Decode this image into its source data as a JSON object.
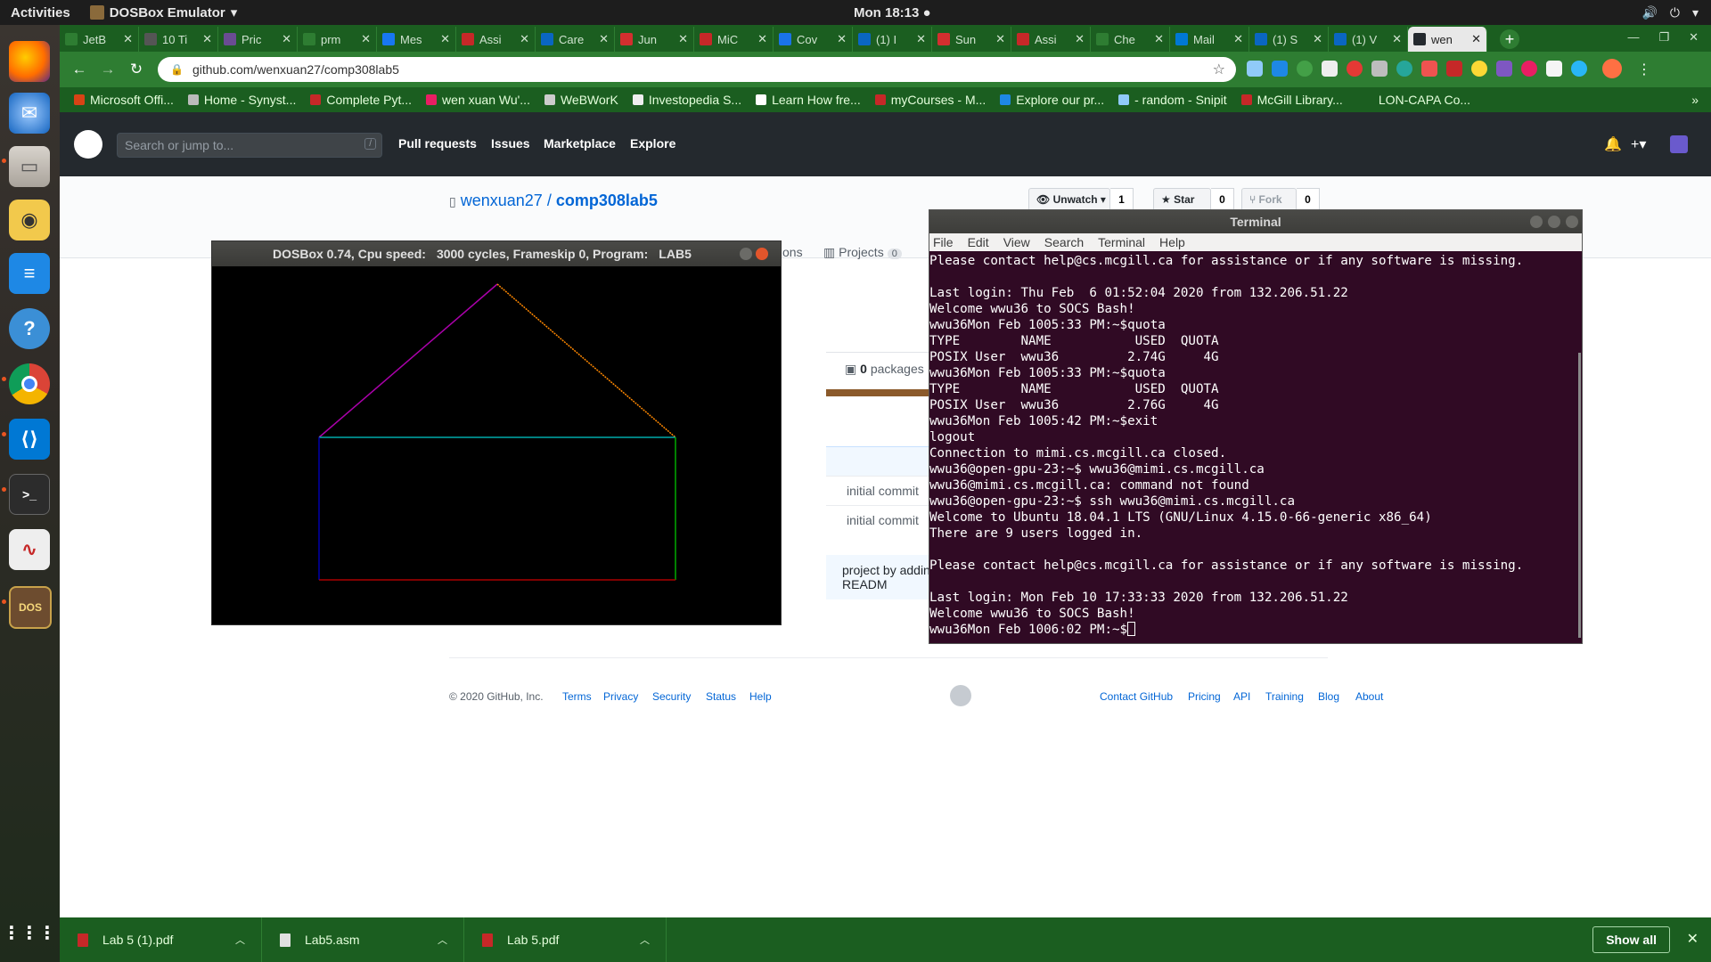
{
  "topbar": {
    "activities": "Activities",
    "app_name": "DOSBox Emulator",
    "clock": "Mon 18:13"
  },
  "dock": {
    "items": [
      "firefox-icon",
      "thunderbird-icon",
      "files-icon",
      "rhythmbox-icon",
      "libreoffice-writer-icon",
      "help-icon",
      "chrome-icon",
      "vscode-icon",
      "terminal-icon",
      "evince-icon",
      "dosbox-icon",
      "show-apps-icon"
    ]
  },
  "browser": {
    "tabs": [
      {
        "label": "JetB",
        "color": "#2e7d32"
      },
      {
        "label": "10 Ti",
        "color": "#555555"
      },
      {
        "label": "Pric",
        "color": "#6a4c93"
      },
      {
        "label": "prm",
        "color": "#2e7d32"
      },
      {
        "label": "Mes",
        "color": "#1877f2"
      },
      {
        "label": "Assi",
        "color": "#c62828"
      },
      {
        "label": "Care",
        "color": "#0a66c2"
      },
      {
        "label": "Jun",
        "color": "#d32f2f"
      },
      {
        "label": "MiC",
        "color": "#c62828"
      },
      {
        "label": "Cov",
        "color": "#1a73e8"
      },
      {
        "label": "(1) I",
        "color": "#0a66c2"
      },
      {
        "label": "Sun",
        "color": "#d32f2f"
      },
      {
        "label": "Assi",
        "color": "#c62828"
      },
      {
        "label": "Che",
        "color": "#2e7d32"
      },
      {
        "label": "Mail",
        "color": "#0078d4"
      },
      {
        "label": "(1) S",
        "color": "#0a66c2"
      },
      {
        "label": "(1) V",
        "color": "#0a66c2"
      },
      {
        "label": "wen",
        "color": "#24292e"
      }
    ],
    "url": "github.com/wenxuan27/comp308lab5",
    "bookmarks": [
      "Microsoft Offi...",
      "Home - Synyst...",
      "Complete Pyt...",
      "wen xuan Wu'...",
      "WeBWorK",
      "Investopedia S...",
      "Learn How fre...",
      "myCourses - M...",
      "Explore our pr...",
      "- random - Snipit",
      "McGill Library...",
      "LON-CAPA Co..."
    ]
  },
  "github": {
    "search_placeholder": "Search or jump to...",
    "search_shortcut": "/",
    "nav": [
      "Pull requests",
      "Issues",
      "Marketplace",
      "Explore"
    ],
    "owner": "wenxuan27",
    "separator": "/",
    "repo": "comp308lab5",
    "unwatch_label": "Unwatch",
    "unwatch_count": "1",
    "star_label": "Star",
    "star_count": "0",
    "fork_label": "Fork",
    "fork_count": "0",
    "tab_fragment": "ons",
    "projects_label": "Projects",
    "projects_count": "0",
    "packages_count": "0",
    "packages_label": "packages",
    "commits": [
      "initial commit",
      "initial commit"
    ],
    "readme_prompt": "project by adding a READM",
    "footer": {
      "copyright": "© 2020 GitHub, Inc.",
      "left_links": [
        "Terms",
        "Privacy",
        "Security",
        "Status",
        "Help"
      ],
      "right_links": [
        "Contact GitHub",
        "Pricing",
        "API",
        "Training",
        "Blog",
        "About"
      ]
    }
  },
  "dosbox": {
    "title_prefix": "DOSBox 0.74, Cpu speed:",
    "title_cycles": "3000 cycles, Frameskip  0, Program:",
    "title_program": "LAB5"
  },
  "terminal": {
    "title": "Terminal",
    "menu": [
      "File",
      "Edit",
      "View",
      "Search",
      "Terminal",
      "Help"
    ],
    "lines": [
      "Please contact help@cs.mcgill.ca for assistance or if any software is missing.",
      "",
      "Last login: Thu Feb  6 01:52:04 2020 from 132.206.51.22",
      "Welcome wwu36 to SOCS Bash!",
      "wwu36Mon Feb 1005:33 PM:~$quota",
      "TYPE        NAME           USED  QUOTA",
      "POSIX User  wwu36         2.74G     4G",
      "wwu36Mon Feb 1005:33 PM:~$quota",
      "TYPE        NAME           USED  QUOTA",
      "POSIX User  wwu36         2.76G     4G",
      "wwu36Mon Feb 1005:42 PM:~$exit",
      "logout",
      "Connection to mimi.cs.mcgill.ca closed.",
      "wwu36@open-gpu-23:~$ wwu36@mimi.cs.mcgill.ca",
      "wwu36@mimi.cs.mcgill.ca: command not found",
      "wwu36@open-gpu-23:~$ ssh wwu36@mimi.cs.mcgill.ca",
      "Welcome to Ubuntu 18.04.1 LTS (GNU/Linux 4.15.0-66-generic x86_64)",
      "There are 9 users logged in.",
      "",
      "Please contact help@cs.mcgill.ca for assistance or if any software is missing.",
      "",
      "Last login: Mon Feb 10 17:33:33 2020 from 132.206.51.22",
      "Welcome wwu36 to SOCS Bash!"
    ],
    "prompt": "wwu36Mon Feb 1006:02 PM:~$"
  },
  "downloads": {
    "files": [
      "Lab 5 (1).pdf",
      "Lab5.asm",
      "Lab 5.pdf"
    ],
    "show_all": "Show all"
  }
}
